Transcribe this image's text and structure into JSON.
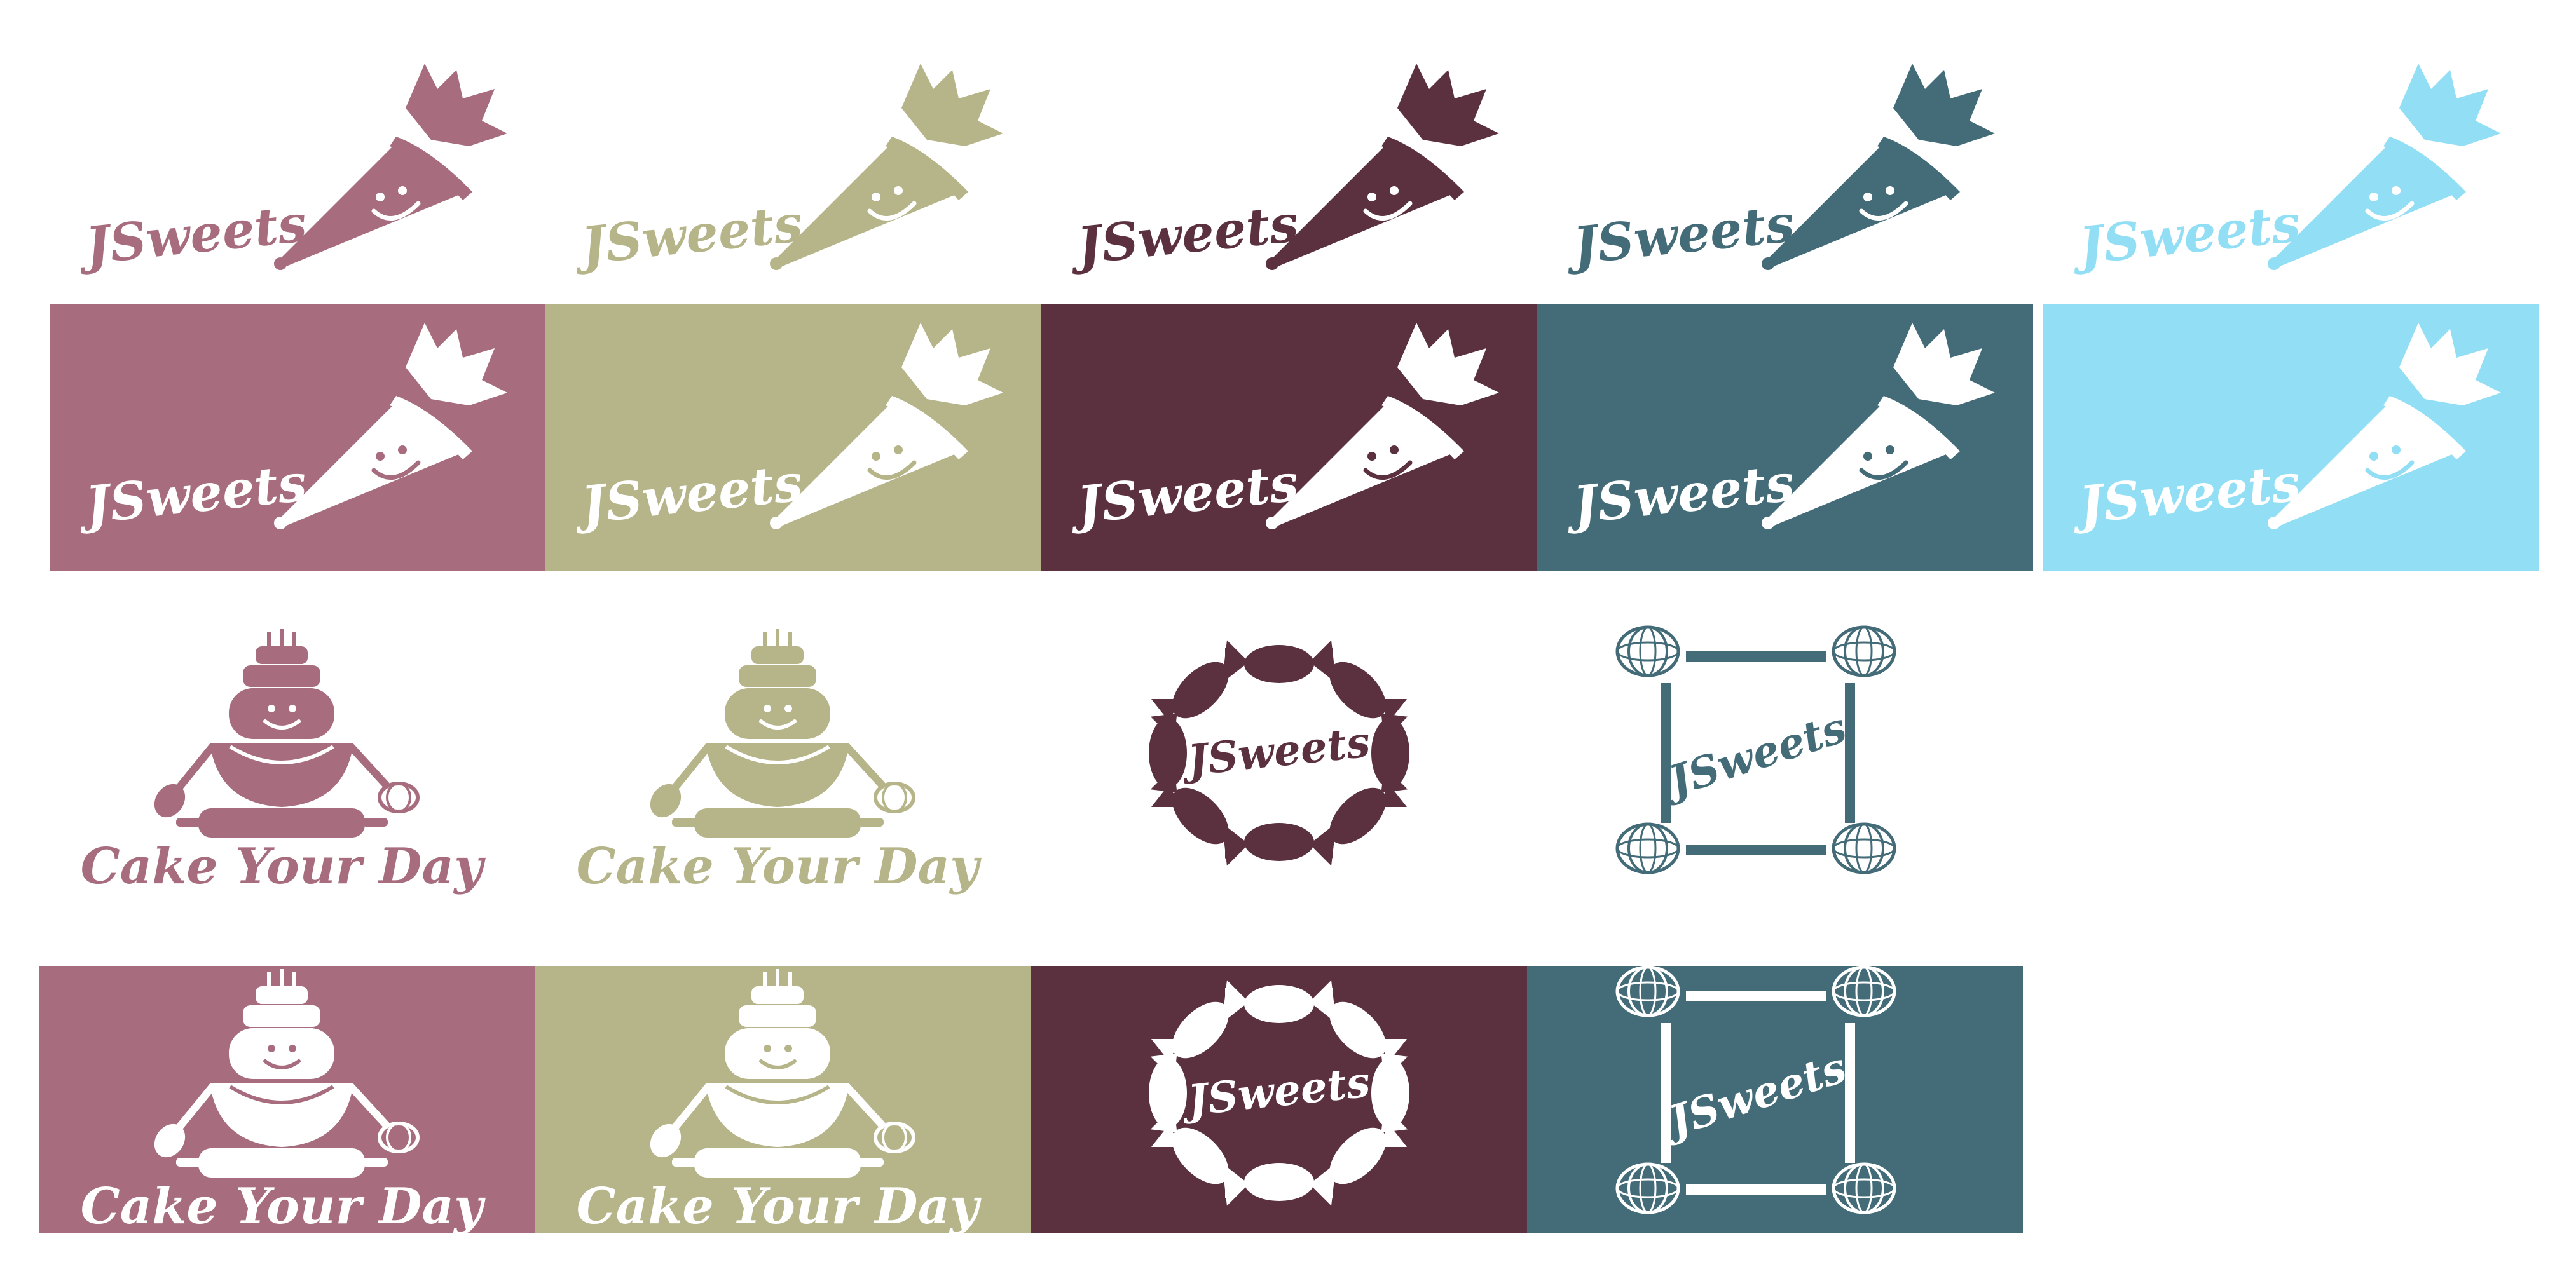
{
  "brand": {
    "wordmark": "JSweets",
    "tagline": "Cake Your Day"
  },
  "palette": {
    "rose": "#A76C7E",
    "olive": "#B6B489",
    "plum": "#5B3140",
    "teal": "#436B78",
    "sky": "#92DFF5",
    "white": "#FFFFFF"
  },
  "rows": [
    {
      "id": "row-1",
      "variants": [
        {
          "style": "piping-bag",
          "fg": "#A76C7E",
          "bg": "#FFFFFF"
        },
        {
          "style": "piping-bag",
          "fg": "#B6B489",
          "bg": "#FFFFFF"
        },
        {
          "style": "piping-bag",
          "fg": "#5B3140",
          "bg": "#FFFFFF"
        },
        {
          "style": "piping-bag",
          "fg": "#436B78",
          "bg": "#FFFFFF"
        },
        {
          "style": "piping-bag",
          "fg": "#92DFF5",
          "bg": "#FFFFFF"
        }
      ]
    },
    {
      "id": "row-2",
      "variants": [
        {
          "style": "piping-bag",
          "fg": "#FFFFFF",
          "bg": "#A76C7E"
        },
        {
          "style": "piping-bag",
          "fg": "#FFFFFF",
          "bg": "#B6B489"
        },
        {
          "style": "piping-bag",
          "fg": "#FFFFFF",
          "bg": "#5B3140"
        },
        {
          "style": "piping-bag",
          "fg": "#FFFFFF",
          "bg": "#436B78"
        },
        {
          "style": "piping-bag",
          "fg": "#FFFFFF",
          "bg": "#92DFF5"
        }
      ]
    },
    {
      "id": "row-3",
      "variants": [
        {
          "style": "baker",
          "fg": "#A76C7E",
          "bg": "#FFFFFF"
        },
        {
          "style": "baker",
          "fg": "#B6B489",
          "bg": "#FFFFFF"
        },
        {
          "style": "candy-wreath",
          "fg": "#5B3140",
          "bg": "#FFFFFF"
        },
        {
          "style": "whisk-frame",
          "fg": "#436B78",
          "bg": "#FFFFFF"
        }
      ]
    },
    {
      "id": "row-4",
      "variants": [
        {
          "style": "baker",
          "fg": "#FFFFFF",
          "bg": "#A76C7E"
        },
        {
          "style": "baker",
          "fg": "#FFFFFF",
          "bg": "#B6B489"
        },
        {
          "style": "candy-wreath",
          "fg": "#FFFFFF",
          "bg": "#5B3140"
        },
        {
          "style": "whisk-frame",
          "fg": "#FFFFFF",
          "bg": "#436B78"
        }
      ]
    }
  ],
  "icons": {
    "piping-bag": "piping-bag-icon",
    "baker": "baker-icon",
    "candy-wreath": "candy-wreath-icon",
    "whisk-frame": "whisk-frame-icon"
  }
}
